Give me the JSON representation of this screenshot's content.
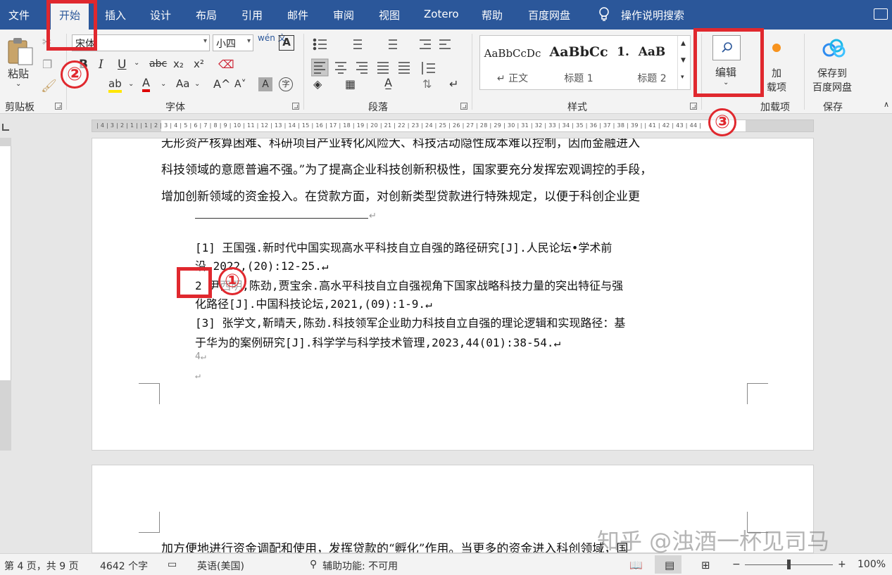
{
  "menubar": {
    "tabs": [
      "文件",
      "开始",
      "插入",
      "设计",
      "布局",
      "引用",
      "邮件",
      "审阅",
      "视图",
      "Zotero",
      "帮助",
      "百度网盘"
    ],
    "search_label": "操作说明搜索",
    "active_tab": "开始",
    "bg_color": "#2b579a"
  },
  "ribbon": {
    "clipboard": {
      "paste_label": "粘贴",
      "group_label": "剪贴板"
    },
    "font": {
      "font_name": "宋体",
      "font_size": "小四",
      "wen_label": "wén 文",
      "A_box": "A",
      "bold": "B",
      "italic": "I",
      "underline": "U",
      "strike": "abc",
      "sub": "x₂",
      "sup": "x²",
      "grow": "A^",
      "shrink": "A˅",
      "change_case": "Aa",
      "char_shade": "A",
      "group_label": "字体"
    },
    "paragraph": {
      "group_label": "段落"
    },
    "styles": {
      "items": [
        {
          "sample": "AaBbCcDc",
          "name": "↵ 正文"
        },
        {
          "sample": "AaBbCc",
          "name": "标题 1"
        },
        {
          "sample": "1.",
          "name": ""
        },
        {
          "sample": "AaB",
          "name": "标题 2"
        }
      ],
      "group_label": "样式"
    },
    "editing": {
      "label": "编辑"
    },
    "addins": {
      "label": "加\n载项",
      "label_line1": "加",
      "label_line2": "载项",
      "group_label": "加载项"
    },
    "save": {
      "label_line1": "保存到",
      "label_line2": "百度网盘",
      "group_label": "保存"
    }
  },
  "annotations": {
    "one": "①",
    "two": "②",
    "three": "③",
    "color": "#e0282e"
  },
  "ruler": {
    "numbers": "| 4 | 3 | 2 | 1 |   | 1 | 2 | 3 | 4 | 5 | 6 | 7 | 8 | 9 | 10 | 11 | 12 | 13 | 14 | 15 | 16 | 17 | 18 | 19 | 20 | 21 | 22 | 23 | 24 | 25 | 26 | 27 | 28 | 29 | 30 | 31 | 32 | 33 | 34 | 35 | 36 | 37 | 38 | 39 |   | 41 | 42 | 43 | 44 |"
  },
  "document": {
    "page1_lines": [
      "无形资产核算困难、科研项目产业转化风险大、科技活动隐性成本难以控制，因而金融进入",
      "科技领域的意愿普遍不强。”为了提高企业科技创新积极性，国家要充分发挥宏观调控的手段，",
      "增加创新领域的资金投入。在贷款方面，对创新类型贷款进行特殊规定，以便于科创企业更"
    ],
    "footnote_rule_mark": "↵",
    "references": [
      "[1] 王国强.新时代中国实现高水平科技自立自强的路径研究[J].人民论坛•学术前",
      "沿,2022,(20):12-25.↵",
      "2 尹西明,陈劲,贾宝余.高水平科技自立自强视角下国家战略科技力量的突出特征与强",
      "化路径[J].中国科技论坛,2021,(09):1-9.↵",
      "[3] 张学文,靳晴天,陈劲.科技领军企业助力科技自立自强的理论逻辑和实现路径：基",
      "于华为的案例研究[J].科学学与科学技术管理,2023,44(01):38-54.↵",
      "4↵",
      "↵"
    ],
    "page2_line": "加方便地进行资金调配和使用，发挥贷款的“孵化”作用。当更多的资金进入科创领域，国"
  },
  "statusbar": {
    "page_info": "第 4 页，共 9 页",
    "word_count": "4642 个字",
    "language": "英语(美国)",
    "accessibility": "辅助功能: 不可用",
    "zoom_minus": "−",
    "zoom_plus": "+",
    "zoom_level": "100%"
  },
  "watermark": "知乎 @浊酒一杯见司马"
}
